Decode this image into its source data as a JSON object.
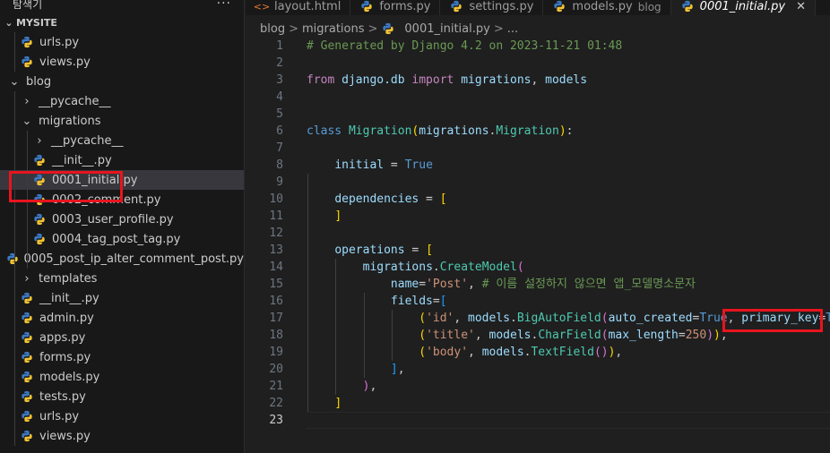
{
  "sidebar": {
    "title": "탐색기",
    "more": "···",
    "section": "MYSITE",
    "items": [
      {
        "label": "urls.py",
        "type": "file",
        "depth": 1
      },
      {
        "label": "views.py",
        "type": "file",
        "depth": 1
      },
      {
        "label": "blog",
        "type": "folder-open",
        "depth": 0
      },
      {
        "label": "__pycache__",
        "type": "folder",
        "depth": 1
      },
      {
        "label": "migrations",
        "type": "folder-open",
        "depth": 1
      },
      {
        "label": "__pycache__",
        "type": "folder",
        "depth": 2
      },
      {
        "label": "__init__.py",
        "type": "file",
        "depth": 2
      },
      {
        "label": "0001_initial.py",
        "type": "file",
        "depth": 2,
        "selected": true
      },
      {
        "label": "0002_comment.py",
        "type": "file",
        "depth": 2
      },
      {
        "label": "0003_user_profile.py",
        "type": "file",
        "depth": 2
      },
      {
        "label": "0004_tag_post_tag.py",
        "type": "file",
        "depth": 2
      },
      {
        "label": "0005_post_ip_alter_comment_post.py",
        "type": "file",
        "depth": 2
      },
      {
        "label": "templates",
        "type": "folder",
        "depth": 1
      },
      {
        "label": "__init__.py",
        "type": "file",
        "depth": 1
      },
      {
        "label": "admin.py",
        "type": "file",
        "depth": 1
      },
      {
        "label": "apps.py",
        "type": "file",
        "depth": 1
      },
      {
        "label": "forms.py",
        "type": "file",
        "depth": 1
      },
      {
        "label": "models.py",
        "type": "file",
        "depth": 1
      },
      {
        "label": "tests.py",
        "type": "file",
        "depth": 1
      },
      {
        "label": "urls.py",
        "type": "file",
        "depth": 1
      },
      {
        "label": "views.py",
        "type": "file",
        "depth": 1
      }
    ]
  },
  "tabs": [
    {
      "label": "layout.html",
      "hint": "",
      "active": false
    },
    {
      "label": "forms.py",
      "hint": "",
      "active": false
    },
    {
      "label": "settings.py",
      "hint": "",
      "active": false
    },
    {
      "label": "models.py",
      "hint": "blog",
      "active": false
    },
    {
      "label": "0001_initial.py",
      "hint": "",
      "active": true
    }
  ],
  "breadcrumb": {
    "parts": [
      "blog",
      "migrations",
      "0001_initial.py",
      "..."
    ],
    "sep": ">"
  },
  "editor": {
    "current_line": 23,
    "line_numbers": [
      "1",
      "2",
      "3",
      "4",
      "5",
      "6",
      "7",
      "8",
      "9",
      "10",
      "11",
      "12",
      "13",
      "14",
      "15",
      "16",
      "17",
      "18",
      "19",
      "20",
      "21",
      "22",
      "23"
    ],
    "lines": [
      [
        [
          "c",
          "# Generated by Django 4.2 on 2023-11-21 01:48"
        ]
      ],
      [],
      [
        [
          "kf",
          "from"
        ],
        [
          "",
          ""
        ],
        [
          "v",
          " django.db "
        ],
        [
          "kf",
          "import"
        ],
        [
          "v",
          " migrations"
        ],
        [
          "",
          ", "
        ],
        [
          "v",
          "models"
        ]
      ],
      [],
      [],
      [
        [
          "k",
          "class"
        ],
        [
          "",
          " "
        ],
        [
          "cls",
          "Migration"
        ],
        [
          "b",
          "("
        ],
        [
          "v",
          "migrations"
        ],
        [
          "",
          "."
        ],
        [
          "cls",
          "Migration"
        ],
        [
          "b",
          ")"
        ],
        [
          "",
          ":"
        ]
      ],
      [],
      [
        [
          "",
          "    "
        ],
        [
          "v",
          "initial"
        ],
        [
          "",
          " = "
        ],
        [
          "t",
          "True"
        ]
      ],
      [],
      [
        [
          "",
          "    "
        ],
        [
          "v",
          "dependencies"
        ],
        [
          "",
          " = "
        ],
        [
          "b",
          "["
        ]
      ],
      [
        [
          "",
          "    "
        ],
        [
          "b",
          "]"
        ]
      ],
      [],
      [
        [
          "",
          "    "
        ],
        [
          "v",
          "operations"
        ],
        [
          "",
          " = "
        ],
        [
          "b",
          "["
        ]
      ],
      [
        [
          "",
          "        "
        ],
        [
          "v",
          "migrations"
        ],
        [
          "",
          "."
        ],
        [
          "cls",
          "CreateModel"
        ],
        [
          "b2",
          "("
        ]
      ],
      [
        [
          "",
          "            "
        ],
        [
          "v",
          "name"
        ],
        [
          "",
          "="
        ],
        [
          "s",
          "'Post'"
        ],
        [
          "",
          ", "
        ],
        [
          "c",
          "# 이름 설정하지 않으면 앱_모델명소문자"
        ]
      ],
      [
        [
          "",
          "            "
        ],
        [
          "v",
          "fields"
        ],
        [
          "",
          "="
        ],
        [
          "b3",
          "["
        ]
      ],
      [
        [
          "",
          "                "
        ],
        [
          "b",
          "("
        ],
        [
          "s",
          "'id'"
        ],
        [
          "",
          ", "
        ],
        [
          "v",
          "models"
        ],
        [
          "",
          "."
        ],
        [
          "cls",
          "BigAutoField"
        ],
        [
          "b2",
          "("
        ],
        [
          "v",
          "auto_created"
        ],
        [
          "",
          "="
        ],
        [
          "t",
          "True"
        ],
        [
          "",
          ", "
        ],
        [
          "v",
          "primary_key"
        ],
        [
          "",
          "="
        ],
        [
          "t",
          "Tr"
        ]
      ],
      [
        [
          "",
          "                "
        ],
        [
          "b",
          "("
        ],
        [
          "s",
          "'title'"
        ],
        [
          "",
          ", "
        ],
        [
          "v",
          "models"
        ],
        [
          "",
          "."
        ],
        [
          "cls",
          "CharField"
        ],
        [
          "b2",
          "("
        ],
        [
          "v",
          "max_length"
        ],
        [
          "",
          "="
        ],
        [
          "s",
          "250"
        ],
        [
          "b2",
          ")"
        ],
        [
          "b",
          ")"
        ],
        [
          "",
          ","
        ]
      ],
      [
        [
          "",
          "                "
        ],
        [
          "b",
          "("
        ],
        [
          "s",
          "'body'"
        ],
        [
          "",
          ", "
        ],
        [
          "v",
          "models"
        ],
        [
          "",
          "."
        ],
        [
          "cls",
          "TextField"
        ],
        [
          "b2",
          "("
        ],
        [
          "b2",
          ")"
        ],
        [
          "b",
          ")"
        ],
        [
          "",
          ","
        ]
      ],
      [
        [
          "",
          "            "
        ],
        [
          "b3",
          "]"
        ],
        [
          "",
          ","
        ]
      ],
      [
        [
          "",
          "        "
        ],
        [
          "b2",
          ")"
        ],
        [
          "",
          ","
        ]
      ],
      [
        [
          "",
          "    "
        ],
        [
          "b",
          "]"
        ]
      ],
      []
    ]
  },
  "colors": {
    "annotation": "#e8141e",
    "python_icon_blue": "#3b78c2",
    "python_icon_yellow": "#f2c232"
  }
}
